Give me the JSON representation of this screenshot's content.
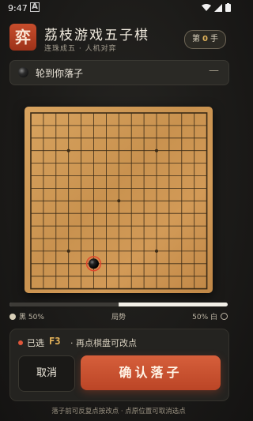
{
  "status_bar": {
    "time": "9:47",
    "notification_icon": "A"
  },
  "app": {
    "logo_char": "弈",
    "title": "荔枝游戏五子棋",
    "subtitle": "连珠成五 · 人机对弈",
    "move_counter": {
      "prefix": "第",
      "value": "0",
      "suffix": "手"
    }
  },
  "turn": {
    "text": "轮到你落子",
    "collapse_symbol": "—"
  },
  "board": {
    "size": 15,
    "star_points": [
      "D4",
      "L4",
      "H8",
      "D12",
      "L12"
    ],
    "stones": [],
    "selected": {
      "coord": "F3",
      "color": "black"
    },
    "colors": {
      "wood": "#d29a57",
      "line": "#3a2a16",
      "highlight": "#e0452c"
    }
  },
  "advantage": {
    "black_label": "黑 50%",
    "center_label": "局势",
    "white_label": "50% 白",
    "black_fraction": 0.5
  },
  "action": {
    "selected_label": "已选",
    "selected_coord": "F3",
    "selected_hint": "· 再点棋盘可改点",
    "cancel_label": "取消",
    "confirm_label": "确认落子"
  },
  "footer_hint": "落子前可反复点按改点 · 点原位置可取消选点",
  "accent_colors": {
    "primary": "#c94a2a",
    "gold": "#e1b35a"
  }
}
